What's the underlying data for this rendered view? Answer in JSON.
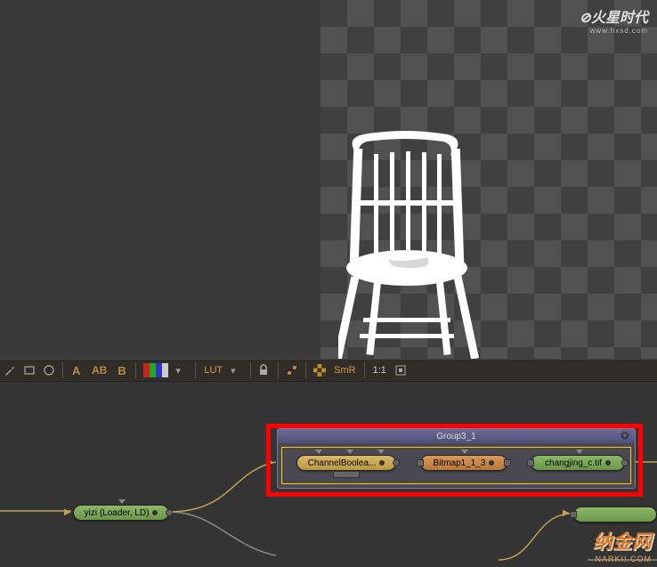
{
  "watermark_top": {
    "title": "火星时代",
    "url": "www.hxsd.com"
  },
  "watermark_bottom": {
    "title": "纳金网",
    "url": "NARKII.COM"
  },
  "toolbar": {
    "text_a": "A",
    "text_ab": "AB",
    "text_b": "B",
    "lut_label": "LUT",
    "smr_label": "SmR",
    "ratio_label": "1:1"
  },
  "flow": {
    "group_title": "Group3_1",
    "nodes": {
      "channelbool": "ChannelBoolea...",
      "bitmap": "Bitmap1_1_3",
      "changjing": "changjing_c.tif",
      "yizi": "yizi (Loader, LD)"
    }
  }
}
